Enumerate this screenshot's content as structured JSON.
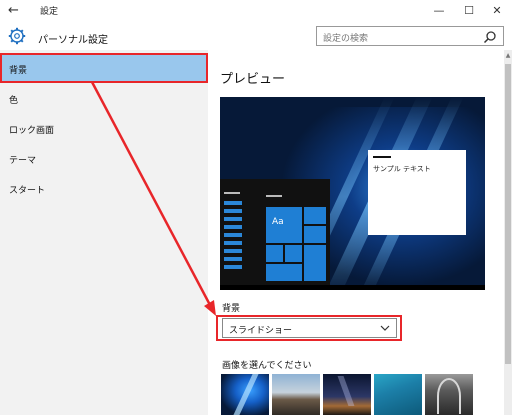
{
  "window": {
    "title": "設定",
    "back_glyph": "←",
    "minimize_glyph": "—",
    "maximize_glyph": "☐",
    "close_glyph": "✕"
  },
  "header": {
    "app_title": "パーソナル設定",
    "search_placeholder": "設定の検索"
  },
  "sidebar": {
    "items": [
      {
        "label": "背景",
        "selected": true
      },
      {
        "label": "色",
        "selected": false
      },
      {
        "label": "ロック画面",
        "selected": false
      },
      {
        "label": "テーマ",
        "selected": false
      },
      {
        "label": "スタート",
        "selected": false
      }
    ]
  },
  "main": {
    "preview_title": "プレビュー",
    "preview": {
      "tile_text": "Aa",
      "sample_text": "サンプル テキスト"
    },
    "background_label": "背景",
    "background_value": "スライドショー",
    "choose_label": "画像を選んでください"
  },
  "colors": {
    "selection": "#99c7ed",
    "annotation_red": "#e8262a",
    "accent_blue": "#1f7fd4"
  },
  "icons": {
    "back": "back-arrow-icon",
    "settings": "gear-icon",
    "search": "search-icon",
    "dropdown": "chevron-down-icon"
  }
}
